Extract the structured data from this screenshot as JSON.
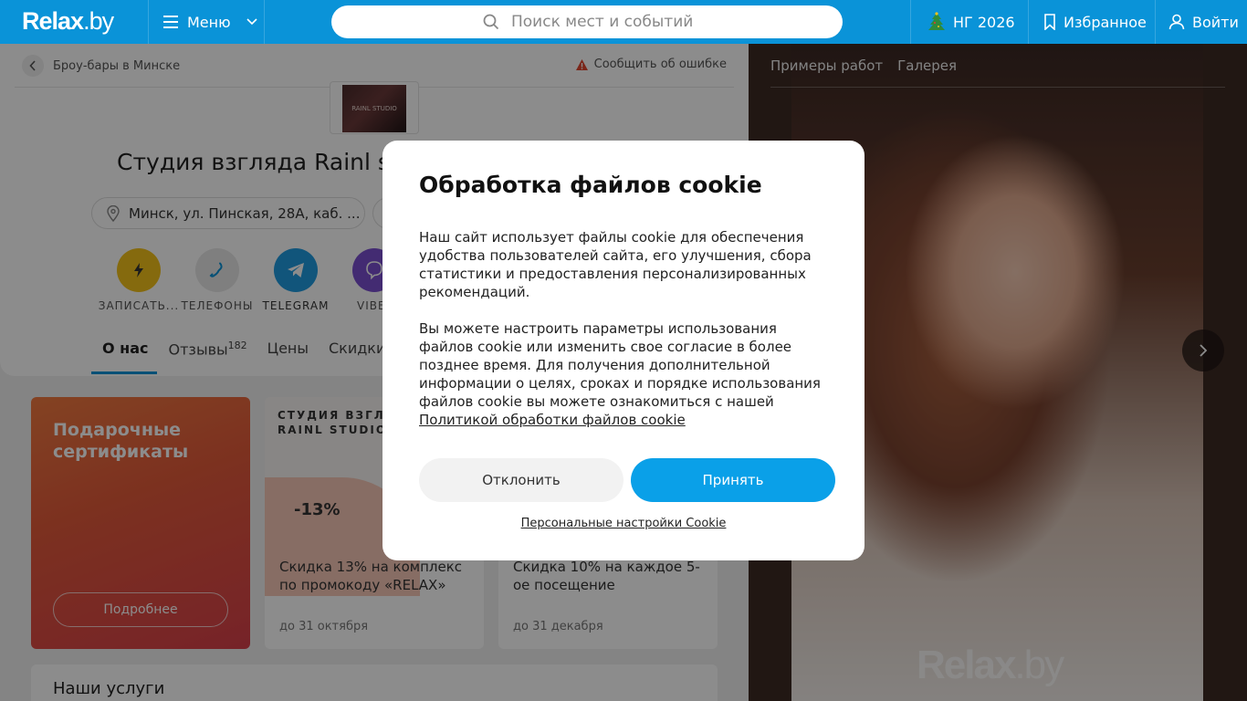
{
  "header": {
    "logo_main": "Relax",
    "logo_dot": ".by",
    "menu_label": "Меню",
    "search_placeholder": "Поиск мест и событий",
    "ny_label": "НГ 2026",
    "favorites_label": "Избранное",
    "login_label": "Войти"
  },
  "page": {
    "breadcrumb": "Броу-бары в Минске",
    "report_label": "Сообщить об ошибке",
    "avatar_text": "RAINL STUDIO",
    "title": "Студия взгляда Rainl st",
    "address": "Минск, ул. Пинская, 28А, каб. ...",
    "actions": [
      {
        "label": "ЗАПИСАТЬ...",
        "color": "#f3c21b"
      },
      {
        "label": "ТЕЛЕФОНЫ",
        "color": "#e8e8e8"
      },
      {
        "label": "TELEGRAM",
        "color": "#1f9be0"
      },
      {
        "label": "VIBE",
        "color": "#7a4fd0"
      }
    ],
    "tabs": [
      {
        "label": "О нас",
        "active": true
      },
      {
        "label": "Отзывы",
        "count": "182"
      },
      {
        "label": "Цены"
      },
      {
        "label": "Скидки"
      }
    ],
    "gift_title": "Подарочные сертификаты",
    "gift_button": "Подробнее",
    "promos": [
      {
        "studio": "СТУДИЯ ВЗГЛЯД\nRAINL STUDIO",
        "discount": "-13%",
        "text": "Скидка 13% на комплекс по промокоду «RELAX»",
        "date": "до 31 октября"
      },
      {
        "text": "Скидка 10% на каждое 5-ое посещение",
        "date": "до 31 декабря"
      }
    ],
    "services_title": "Наши услуги"
  },
  "gallery": {
    "tabs": [
      "Примеры работ",
      "Галерея"
    ],
    "watermark_main": "Relax",
    "watermark_dot": ".by"
  },
  "cookie_modal": {
    "title": "Обработка файлов cookie",
    "paragraph1": "Наш сайт использует файлы cookie для обеспечения удобства пользователей сайта, его улучшения, сбора статистики и предоставления персонализированных рекомендаций.",
    "paragraph2": "Вы можете настроить параметры использования файлов cookie или изменить свое согласие в более позднее время. Для получения дополнительной информации о целях, сроках и порядке использования файлов cookie вы можете ознакомиться с нашей",
    "policy_link": "Политикой обработки файлов cookie",
    "decline_label": "Отклонить",
    "accept_label": "Принять",
    "settings_link": "Персональные настройки Cookie"
  },
  "colors": {
    "brand_blue": "#0a93d8",
    "accept_blue": "#0aa0e8"
  }
}
